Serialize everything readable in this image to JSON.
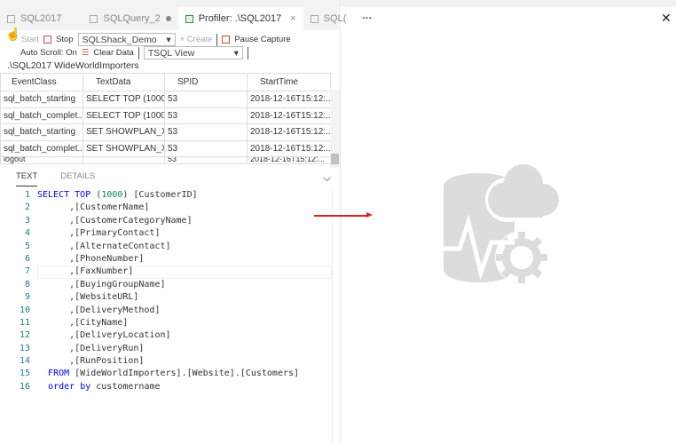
{
  "tabs": [
    {
      "label": "SQL2017"
    },
    {
      "label": "SQLQuery_2"
    },
    {
      "label": "Profiler: .\\SQL2017"
    },
    {
      "label": "SQL("
    }
  ],
  "toolbar": {
    "start": "Start",
    "stop": "Stop",
    "session": "SQLShack_Demo",
    "create": "+ Create",
    "pause": "Pause Capture",
    "autoscroll": "Auto Scroll: On",
    "clear": "Clear Data",
    "view": "TSQL View"
  },
  "server_path": ".\\SQL2017 WideWorldImporters",
  "grid": {
    "columns": [
      "EventClass",
      "TextData",
      "SPID",
      "StartTime"
    ],
    "rows": [
      [
        "sql_batch_starting",
        "SELECT TOP (1000...",
        "53",
        "2018-12-16T15:12:..."
      ],
      [
        "sql_batch_complet...",
        "SELECT TOP (1000...",
        "53",
        "2018-12-16T15:12:..."
      ],
      [
        "sql_batch_starting",
        "SET SHOWPLAN_X...",
        "53",
        "2018-12-16T15:12:..."
      ],
      [
        "sql_batch_complet...",
        "SET SHOWPLAN_X...",
        "53",
        "2018-12-16T15:12:..."
      ],
      [
        "logout",
        "",
        "53",
        "2018-12-16T15:12:..."
      ]
    ]
  },
  "details": {
    "tab_text": "TEXT",
    "tab_details": "DETAILS"
  },
  "code": [
    {
      "n": "1",
      "t": "SELECT TOP (1000) [CustomerID]"
    },
    {
      "n": "2",
      "t": "      ,[CustomerName]"
    },
    {
      "n": "3",
      "t": "      ,[CustomerCategoryName]"
    },
    {
      "n": "4",
      "t": "      ,[PrimaryContact]"
    },
    {
      "n": "5",
      "t": "      ,[AlternateContact]"
    },
    {
      "n": "6",
      "t": "      ,[PhoneNumber]"
    },
    {
      "n": "7",
      "t": "      ,[FaxNumber]"
    },
    {
      "n": "8",
      "t": "      ,[BuyingGroupName]"
    },
    {
      "n": "9",
      "t": "      ,[WebsiteURL]"
    },
    {
      "n": "10",
      "t": "      ,[DeliveryMethod]"
    },
    {
      "n": "11",
      "t": "      ,[CityName]"
    },
    {
      "n": "12",
      "t": "      ,[DeliveryLocation]"
    },
    {
      "n": "13",
      "t": "      ,[DeliveryRun]"
    },
    {
      "n": "14",
      "t": "      ,[RunPosition]"
    },
    {
      "n": "15",
      "t": "  FROM [WideWorldImporters].[Website].[Customers]"
    },
    {
      "n": "16",
      "t": "  order by customername"
    }
  ],
  "colors": {
    "keyword": "#0000ff",
    "number": "#09885a",
    "accent_red": "#d9442a"
  }
}
